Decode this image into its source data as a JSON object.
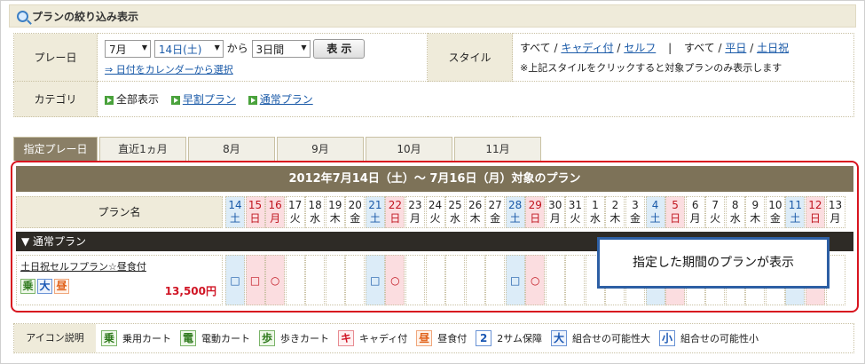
{
  "filter": {
    "title": "プランの絞り込み表示",
    "play_day_label": "プレー日",
    "month_value": "7月",
    "day_value": "14日(土)",
    "from_text": "から",
    "period_value": "3日間",
    "show_button": "表 示",
    "calendar_link": "⇒ 日付をカレンダーから選択",
    "style_label": "スタイル",
    "style_line1_a": "すべて /",
    "style_caddy": "キャディ付",
    "style_slash1": "/",
    "style_self": "セルフ",
    "style_sep": "|",
    "style_line1_b": "すべて /",
    "style_weekday": "平日",
    "style_slash2": "/",
    "style_holiday": "土日祝",
    "style_note": "※上記スタイルをクリックすると対象プランのみ表示します",
    "category_label": "カテゴリ",
    "cat_all": "全部表示",
    "cat_early": "早割プラン",
    "cat_normal": "通常プラン"
  },
  "tabs": [
    {
      "label": "指定プレー日",
      "active": true
    },
    {
      "label": "直近1ヵ月"
    },
    {
      "label": "8月"
    },
    {
      "label": "9月"
    },
    {
      "label": "10月"
    },
    {
      "label": "11月"
    }
  ],
  "panel": {
    "title": "2012年7月14日（土）～ 7月16日（月）対象のプラン",
    "plan_name_header": "プラン名",
    "section": "▼ 通常プラン",
    "days": [
      {
        "d": "14",
        "w": "土",
        "k": "sat"
      },
      {
        "d": "15",
        "w": "日",
        "k": "sun"
      },
      {
        "d": "16",
        "w": "月",
        "k": "sun"
      },
      {
        "d": "17",
        "w": "火"
      },
      {
        "d": "18",
        "w": "水"
      },
      {
        "d": "19",
        "w": "木"
      },
      {
        "d": "20",
        "w": "金"
      },
      {
        "d": "21",
        "w": "土",
        "k": "sat"
      },
      {
        "d": "22",
        "w": "日",
        "k": "sun"
      },
      {
        "d": "23",
        "w": "月"
      },
      {
        "d": "24",
        "w": "火"
      },
      {
        "d": "25",
        "w": "水"
      },
      {
        "d": "26",
        "w": "木"
      },
      {
        "d": "27",
        "w": "金"
      },
      {
        "d": "28",
        "w": "土",
        "k": "sat"
      },
      {
        "d": "29",
        "w": "日",
        "k": "sun"
      },
      {
        "d": "30",
        "w": "月"
      },
      {
        "d": "31",
        "w": "火"
      },
      {
        "d": "1",
        "w": "水"
      },
      {
        "d": "2",
        "w": "木"
      },
      {
        "d": "3",
        "w": "金"
      },
      {
        "d": "4",
        "w": "土",
        "k": "sat"
      },
      {
        "d": "5",
        "w": "日",
        "k": "sun"
      },
      {
        "d": "6",
        "w": "月"
      },
      {
        "d": "7",
        "w": "火"
      },
      {
        "d": "8",
        "w": "水"
      },
      {
        "d": "9",
        "w": "木"
      },
      {
        "d": "10",
        "w": "金"
      },
      {
        "d": "11",
        "w": "土",
        "k": "sat"
      },
      {
        "d": "12",
        "w": "日",
        "k": "sun"
      },
      {
        "d": "13",
        "w": "月"
      }
    ],
    "plan": {
      "name": "土日祝セルフプラン☆昼食付",
      "icons": [
        "乗",
        "大",
        "昼"
      ],
      "price": "13,500円",
      "marks": [
        "□",
        "□",
        "○",
        "",
        "",
        "",
        "",
        "□",
        "○",
        "",
        "",
        "",
        "",
        "",
        "□",
        "○",
        "",
        "",
        "",
        "",
        "",
        "",
        "",
        "",
        "",
        "",
        "",
        "",
        "",
        "",
        ""
      ]
    },
    "callout": "指定した期間のプランが表示"
  },
  "legend": {
    "title": "アイコン説明",
    "items": [
      {
        "icon": "乗",
        "label": "乗用カート",
        "cls": "jo"
      },
      {
        "icon": "電",
        "label": "電動カート",
        "cls": "den"
      },
      {
        "icon": "歩",
        "label": "歩きカート",
        "cls": "aru"
      },
      {
        "icon": "キ",
        "label": "キャディ付",
        "cls": "ki"
      },
      {
        "icon": "昼",
        "label": "昼食付",
        "cls": "hiru"
      },
      {
        "icon": "2",
        "label": "2サム保障",
        "cls": "ni"
      },
      {
        "icon": "大",
        "label": "組合せの可能性大",
        "cls": "dai"
      },
      {
        "icon": "小",
        "label": "組合せの可能性小",
        "cls": "sho"
      }
    ]
  }
}
